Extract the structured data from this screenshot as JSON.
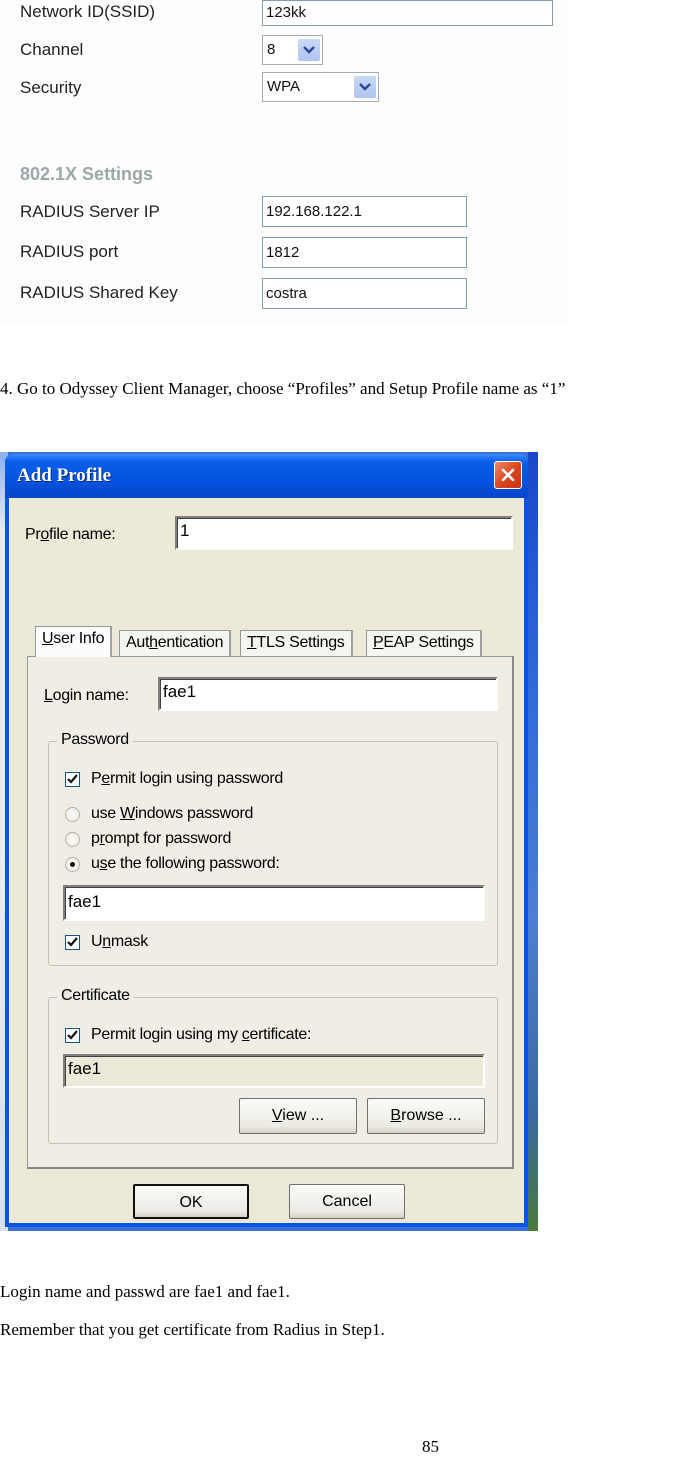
{
  "router_settings": {
    "fields": [
      {
        "label": "Network ID(SSID)",
        "value": "123kk",
        "type": "text"
      },
      {
        "label": "Channel",
        "value": "8",
        "type": "select"
      },
      {
        "label": "Security",
        "value": "WPA",
        "type": "select"
      }
    ],
    "section_title": "802.1X Settings",
    "radius_fields": [
      {
        "label": "RADIUS Server IP",
        "value": "192.168.122.1"
      },
      {
        "label": "RADIUS port",
        "value": "1812"
      },
      {
        "label": "RADIUS Shared Key",
        "value": "costra"
      }
    ]
  },
  "step_text": "4. Go to Odyssey Client Manager, choose “Profiles” and Setup Profile name as “1”",
  "dialog": {
    "title": "Add Profile",
    "close_icon": "close-icon",
    "profile_name_label": "Profile name:",
    "profile_name_value": "1",
    "tabs": [
      {
        "label": "User Info",
        "active": true
      },
      {
        "label": "Authentication",
        "active": false
      },
      {
        "label": "TTLS Settings",
        "active": false
      },
      {
        "label": "PEAP Settings",
        "active": false
      }
    ],
    "login_name_label": "Login name:",
    "login_name_value": "fae1",
    "password_group": {
      "title": "Password",
      "permit_label": "Permit login using password",
      "permit_checked": true,
      "options": [
        {
          "label": "use Windows password",
          "selected": false
        },
        {
          "label": "prompt for password",
          "selected": false
        },
        {
          "label": "use the following password:",
          "selected": true
        }
      ],
      "password_value": "fae1",
      "unmask_label": "Unmask",
      "unmask_checked": true
    },
    "certificate_group": {
      "title": "Certificate",
      "permit_label": "Permit login using my certificate:",
      "permit_checked": true,
      "certificate_value": "fae1",
      "view_button": "View ...",
      "browse_button": "Browse ..."
    },
    "ok_button": "OK",
    "cancel_button": "Cancel"
  },
  "notes": [
    "Login name and passwd are fae1 and fae1.",
    "Remember that you get certificate from Radius in Step1."
  ],
  "page_number": "85"
}
